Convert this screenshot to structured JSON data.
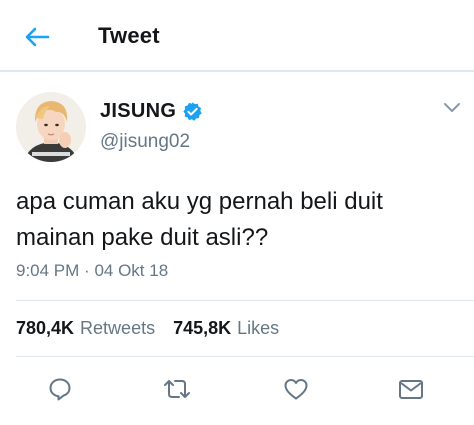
{
  "header": {
    "title": "Tweet",
    "back_icon": "arrow-left-icon",
    "accent_color": "#1da1f2"
  },
  "author": {
    "display_name": "JISUNG",
    "handle": "@jisung02",
    "verified": true,
    "avatar_icon": "avatar-photo"
  },
  "tweet": {
    "line1": "apa cuman aku yg pernah beli duit",
    "line2": "mainan pake duit asli??",
    "time": "9:04 PM",
    "separator": "·",
    "date": "04 Okt 18"
  },
  "stats": {
    "retweets_count": "780,4K",
    "retweets_label": "Retweets",
    "likes_count": "745,8K",
    "likes_label": "Likes"
  },
  "actions": [
    {
      "name": "reply",
      "icon": "reply-icon"
    },
    {
      "name": "retweet",
      "icon": "retweet-icon"
    },
    {
      "name": "like",
      "icon": "heart-icon"
    },
    {
      "name": "message",
      "icon": "mail-icon"
    }
  ],
  "colors": {
    "text": "#14171a",
    "secondary": "#657786",
    "border": "#e1e8ed",
    "verified_badge": "#1da1f2"
  }
}
